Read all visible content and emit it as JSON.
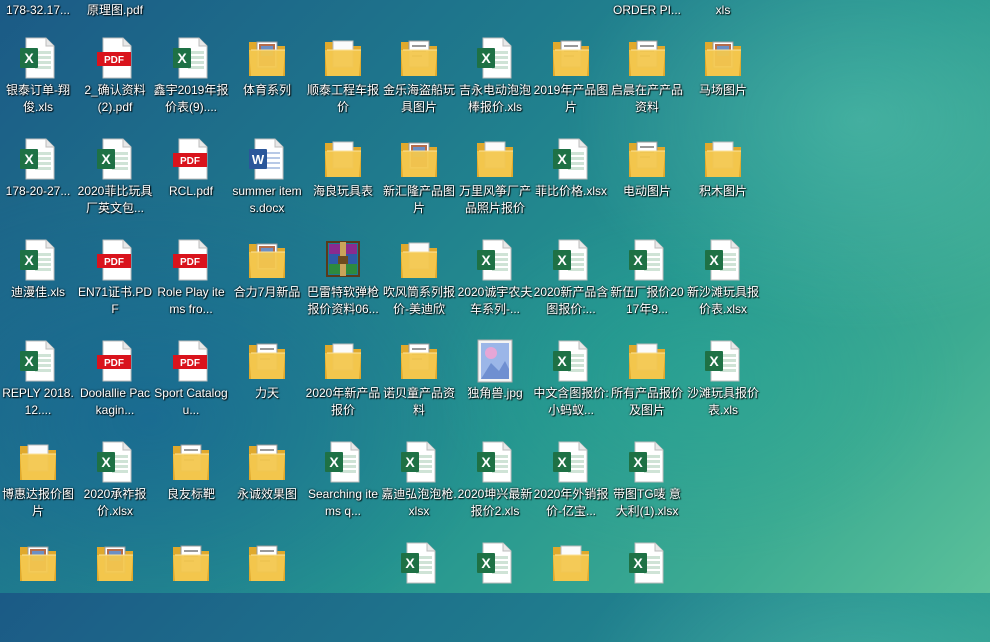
{
  "top_partial": [
    {
      "label": "178-32.17...",
      "col": 0
    },
    {
      "label": "原理图.pdf",
      "col": 1
    },
    {
      "label": "ORDER PI...",
      "col": 8
    },
    {
      "label": "xls",
      "col": 9
    }
  ],
  "grid": [
    [
      {
        "type": "xls",
        "label": "银泰订单-翔俊.xls"
      },
      {
        "type": "pdf",
        "label": "2_确认资料(2).pdf"
      },
      {
        "type": "xls",
        "label": "鑫宇2019年报价表(9)...."
      },
      {
        "type": "folder-pic",
        "label": "体育系列"
      },
      {
        "type": "folder",
        "label": "顺泰工程车报价"
      },
      {
        "type": "folder-doc",
        "label": "金乐海盗船玩具图片"
      },
      {
        "type": "xls",
        "label": "吉永电动泡泡棒报价.xls"
      },
      {
        "type": "folder-doc",
        "label": "2019年产品图片"
      },
      {
        "type": "folder-doc",
        "label": "启晨在产产品资料"
      },
      {
        "type": "folder-pic",
        "label": "马场图片"
      }
    ],
    [
      {
        "type": "xls",
        "label": "178-20-27..."
      },
      {
        "type": "xls",
        "label": "2020菲比玩具厂英文包..."
      },
      {
        "type": "pdf",
        "label": "RCL.pdf"
      },
      {
        "type": "word",
        "label": "summer items.docx"
      },
      {
        "type": "folder",
        "label": "海良玩具表"
      },
      {
        "type": "folder-pic",
        "label": "新汇隆产品图片"
      },
      {
        "type": "folder",
        "label": "万里风筝厂产品照片报价"
      },
      {
        "type": "xls",
        "label": "菲比价格.xlsx"
      },
      {
        "type": "folder-doc",
        "label": "电动图片"
      },
      {
        "type": "folder",
        "label": "积木图片"
      }
    ],
    [
      {
        "type": "xls",
        "label": "迪漫佳.xls"
      },
      {
        "type": "pdf",
        "label": "EN71证书.PDF"
      },
      {
        "type": "pdf",
        "label": "Role Play items fro..."
      },
      {
        "type": "folder-pic",
        "label": "合力7月新品"
      },
      {
        "type": "rar",
        "label": "巴雷特软弹枪报价资料06..."
      },
      {
        "type": "folder",
        "label": "吹风筒系列报价-美迪欣"
      },
      {
        "type": "xls",
        "label": "2020诚宇农夫车系列-..."
      },
      {
        "type": "xls",
        "label": "2020新产品含图报价:..."
      },
      {
        "type": "xls",
        "label": "新伍厂报价2017年9..."
      },
      {
        "type": "xls",
        "label": "新沙滩玩具报价表.xlsx"
      }
    ],
    [
      {
        "type": "xls",
        "label": "REPLY 2018.12...."
      },
      {
        "type": "pdf",
        "label": "Doolallie Packagin..."
      },
      {
        "type": "pdf",
        "label": "Sport Catalogu..."
      },
      {
        "type": "folder-doc",
        "label": "力天"
      },
      {
        "type": "folder",
        "label": "2020年新产品报价"
      },
      {
        "type": "folder-doc",
        "label": "诺贝童产品资料"
      },
      {
        "type": "jpg",
        "label": "独角兽.jpg"
      },
      {
        "type": "xls",
        "label": "中文含图报价:小蚂蚁..."
      },
      {
        "type": "folder",
        "label": "所有产品报价及图片"
      },
      {
        "type": "xls",
        "label": "沙滩玩具报价表.xls"
      }
    ],
    [
      {
        "type": "folder",
        "label": "博惠达报价图片"
      },
      {
        "type": "xls",
        "label": "2020承祚报价.xlsx"
      },
      {
        "type": "folder-doc",
        "label": "良友标靶"
      },
      {
        "type": "folder-doc",
        "label": "永诚效果图"
      },
      {
        "type": "xls",
        "label": "Searching items q..."
      },
      {
        "type": "xls",
        "label": "嘉迪弘泡泡枪.xlsx"
      },
      {
        "type": "xls",
        "label": "2020坤兴最新报价2.xls"
      },
      {
        "type": "xls",
        "label": "2020年外销报价-亿宝..."
      },
      {
        "type": "xls",
        "label": "带图TG唛 意大利(1).xlsx"
      },
      null
    ],
    [
      {
        "type": "folder-pic",
        "label": ""
      },
      {
        "type": "folder-pic",
        "label": ""
      },
      {
        "type": "folder-doc",
        "label": ""
      },
      {
        "type": "folder-doc",
        "label": ""
      },
      null,
      {
        "type": "xls",
        "label": ""
      },
      {
        "type": "xls",
        "label": ""
      },
      {
        "type": "folder",
        "label": ""
      },
      {
        "type": "xls",
        "label": ""
      },
      null
    ]
  ],
  "colors": {
    "excel": "#1e7145",
    "pdf": "#d9131c",
    "word": "#2b579a",
    "folder": "#f3c74e",
    "folder_dark": "#e0a92c"
  }
}
